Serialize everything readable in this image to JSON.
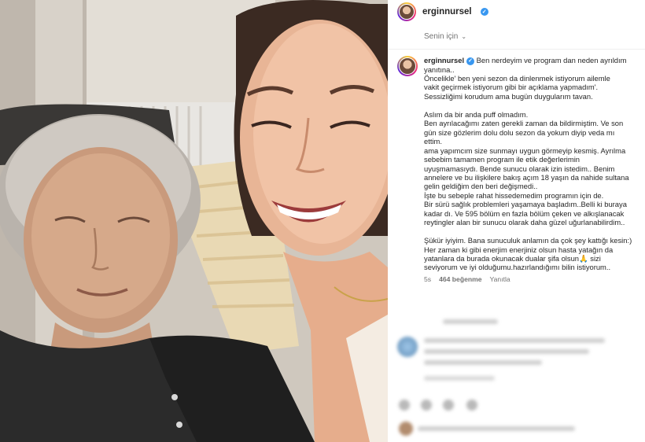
{
  "post": {
    "header_username": "erginnursel",
    "for_you_label": "Senin için",
    "caption_username": "erginnursel",
    "caption_lines": [
      "Ben nerdeyim ve program dan neden ayrıldım",
      "yanıtına..",
      "Öncelikle' ben yeni sezon da dinlenmek istiyorum ailemle",
      "vakit geçirmek istiyorum gibi bir açıklama yapmadım'.",
      "Sessizliğimi korudum ama bugün duygularım tavan.",
      "",
      "Aslım da bir anda puff olmadım.",
      "Ben ayrılacağımı zaten gerekli zaman da bildirmiştim. Ve son",
      "gün size gözlerim dolu dolu sezon da yokum diyip veda mı",
      "ettim.",
      "ama yapımcım size sunmayı uygun görmeyip kesmiş. Ayrılma",
      "sebebim tamamen program ile etik değerlerimin",
      "uyuşmamasıydı. Bende sunucu olarak izin istedim.. Benim",
      "annelere ve bu ilişkilere bakış açım 18 yaşın da nahide sultana",
      "gelin geldiğim den beri değişmedi..",
      "İşte bu sebeple rahat hissedemedim programın için de.",
      "Bir sürü sağlık problemleri yaşamaya başladım..Belli ki buraya",
      "kadar dı. Ve 595 bölüm en fazla bölüm çeken ve alkışlanacak",
      "reytingler alan bir sunucu olarak daha güzel uğurlanabilirdim..",
      "",
      "Şükür iyiyim. Bana sunuculuk anlamın da çok şey kattığı kesin:)",
      "Her zaman ki gibi enerjim enerjiniz olsun hasta yatağın da",
      "yatanlara da burada okunacak dualar şifa olsun🙏 sizi",
      "seviyorum ve iyi olduğumu.hazırlandığımı bilin istiyorum.."
    ],
    "time_ago": "5s",
    "likes": "464 beğenme",
    "reply_label": "Yanıtla"
  },
  "colors": {
    "verified": "#3897f0",
    "text": "#262626",
    "muted": "#737373"
  },
  "icons": [
    "verified-badge-icon",
    "chevron-down-icon"
  ]
}
